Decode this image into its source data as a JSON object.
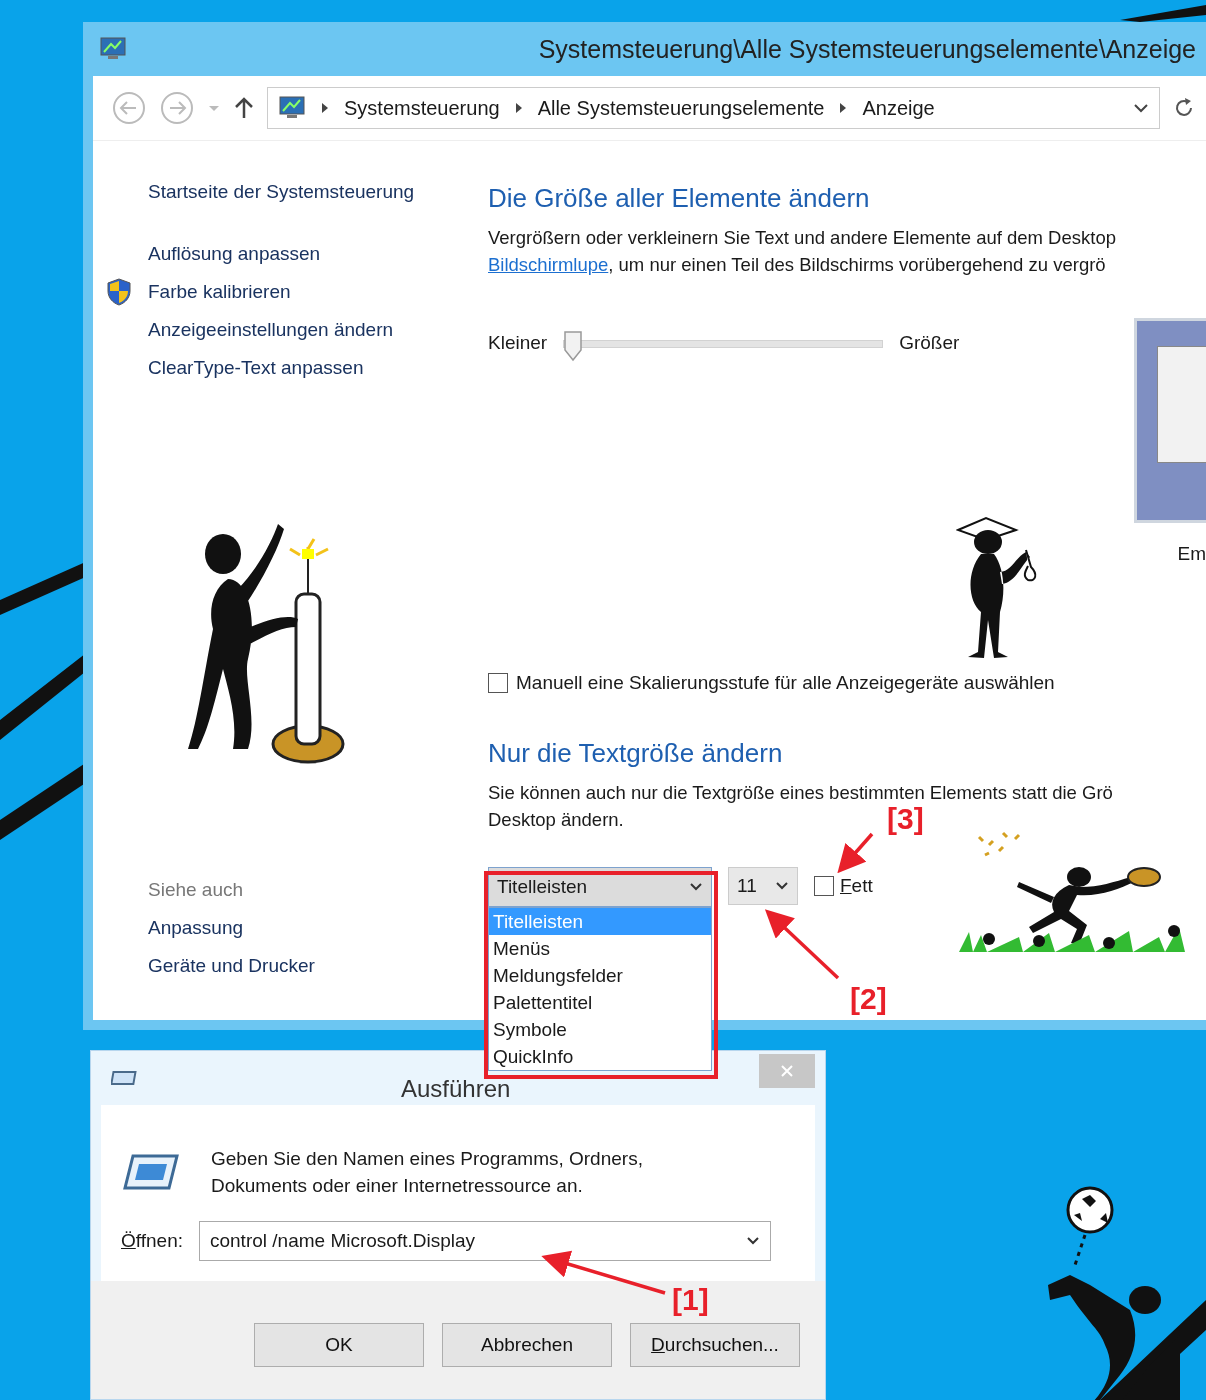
{
  "main_window": {
    "title": "Systemsteuerung\\Alle Systemsteuerungselemente\\Anzeige",
    "breadcrumb": [
      "Systemsteuerung",
      "Alle Systemsteuerungselemente",
      "Anzeige"
    ],
    "sidebar": {
      "home": "Startseite der Systemsteuerung",
      "items": [
        {
          "label": "Auflösung anpassen",
          "kind": "link"
        },
        {
          "label": "Farbe kalibrieren",
          "kind": "shield"
        },
        {
          "label": "Anzeigeeinstellungen ändern",
          "kind": "link"
        },
        {
          "label": "ClearType-Text anpassen",
          "kind": "link"
        }
      ],
      "see_also_title": "Siehe auch",
      "see_also": [
        "Anpassung",
        "Geräte und Drucker"
      ]
    },
    "scale_section": {
      "heading": "Die Größe aller Elemente ändern",
      "description_line": "Vergrößern oder verkleinern Sie Text und andere Elemente auf dem Desktop",
      "link": "Bildschirmlupe",
      "link_suffix": ", um nur einen Teil des Bildschirms vorübergehend zu vergrö",
      "slider": {
        "min_label": "Kleiner",
        "max_label": "Größer",
        "level": 0
      },
      "preview_caption": "Em",
      "manual_checkbox": {
        "label": "Manuell eine Skalierungsstufe für alle Anzeigegeräte auswählen",
        "checked": false
      }
    },
    "text_section": {
      "heading": "Nur die Textgröße ändern",
      "description_lines": [
        "Sie können auch nur die Textgröße eines bestimmten Elements statt die Grö",
        "Desktop ändern."
      ],
      "element_select": {
        "value": "Titelleisten",
        "options": [
          {
            "label": "Titelleisten",
            "selected": true
          },
          {
            "label": "Menüs",
            "selected": false
          },
          {
            "label": "Meldungsfelder",
            "selected": false
          },
          {
            "label": "Palettentitel",
            "selected": false
          },
          {
            "label": "Symbole",
            "selected": false
          },
          {
            "label": "QuickInfo",
            "selected": false
          }
        ]
      },
      "size_select": {
        "value": "11"
      },
      "bold_checkbox": {
        "label": "Fett",
        "checked": false
      }
    }
  },
  "run_dialog": {
    "title": "Ausführen",
    "description": "Geben Sie den Namen eines Programms, Ordners, Dokuments oder einer Internetressource an.",
    "open_label": "Öffnen:",
    "command": "control /name Microsoft.Display",
    "buttons": [
      "OK",
      "Abbrechen",
      "Durchsuchen..."
    ]
  },
  "annotations": [
    {
      "label": "[1]"
    },
    {
      "label": "[2]"
    },
    {
      "label": "[3]"
    }
  ]
}
